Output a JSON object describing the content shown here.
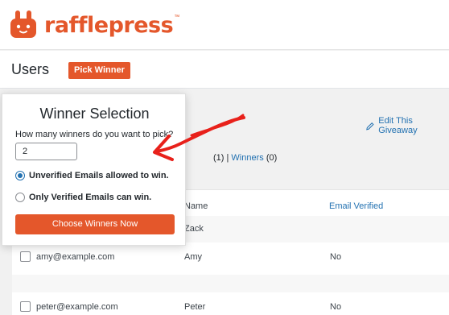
{
  "brand": {
    "name": "rafflepress",
    "tm": "™",
    "accent": "#e4572b"
  },
  "header": {
    "title": "Users",
    "pick_winner_label": "Pick Winner"
  },
  "toolbar": {
    "edit_label": "Edit This Giveaway"
  },
  "counts": {
    "suffix": "(1) |",
    "winners_label": "Winners",
    "winners_count": "(0)"
  },
  "table": {
    "columns": {
      "name": "Name",
      "email_verified": "Email Verified"
    },
    "rows": [
      {
        "email": "",
        "name": "Zack",
        "verified": ""
      },
      {
        "email": "amy@example.com",
        "name": "Amy",
        "verified": "No"
      },
      {
        "email": "peter@example.com",
        "name": "Peter",
        "verified": "No"
      }
    ]
  },
  "modal": {
    "title": "Winner Selection",
    "question": "How many winners do you want to pick?",
    "input_value": "2",
    "options": [
      {
        "label": "Unverified Emails allowed to win.",
        "selected": true
      },
      {
        "label": "Only Verified Emails can win.",
        "selected": false
      }
    ],
    "submit_label": "Choose Winners Now"
  },
  "icons": {
    "logo": "rabbit-logo-icon",
    "edit": "pencil-icon",
    "annotation": "red-arrow-icon"
  }
}
